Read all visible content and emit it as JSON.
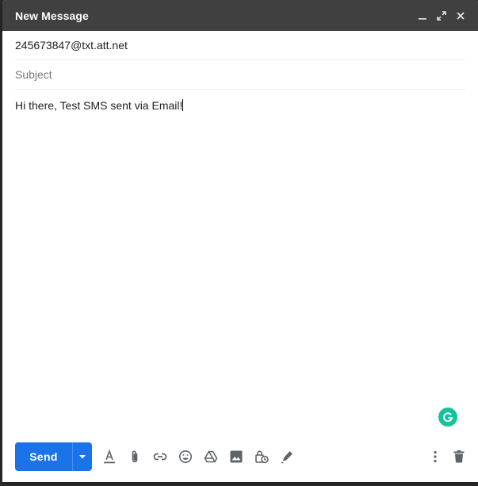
{
  "window": {
    "title": "New Message",
    "controls": [
      "minimize-icon",
      "fullscreen-icon",
      "close-icon"
    ]
  },
  "fields": {
    "to_value": "245673847@txt.att.net",
    "subject_placeholder": "Subject",
    "subject_value": ""
  },
  "body": {
    "text": "Hi there, Test SMS sent via Email!"
  },
  "toolbar": {
    "send_label": "Send",
    "tools": [
      "formatting-icon",
      "attach-icon",
      "link-icon",
      "emoji-icon",
      "drive-icon",
      "photo-icon",
      "confidential-icon",
      "signature-icon"
    ],
    "right_tools": [
      "more-options-icon",
      "discard-icon"
    ]
  },
  "colors": {
    "titlebar": "#404040",
    "send": "#1a73e8",
    "grammarly": "#15c39a",
    "icon": "#5f6368"
  }
}
